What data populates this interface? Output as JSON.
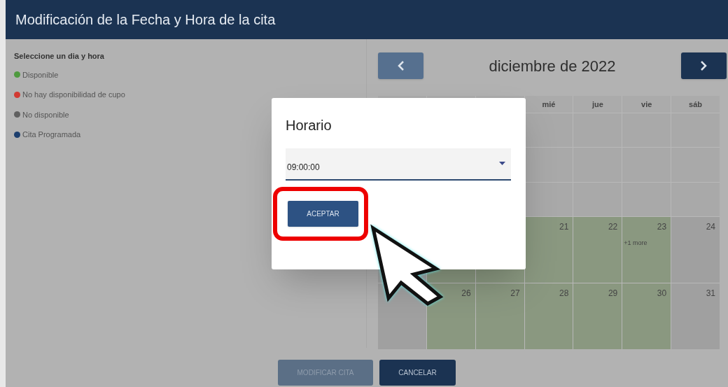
{
  "header": {
    "title": "Modificación de la Fecha y Hora de la cita"
  },
  "legend": {
    "title": "Seleccione un dia y hora",
    "items": [
      {
        "label": "Disponible",
        "color": "#4f9a3f"
      },
      {
        "label": "No hay disponibilidad de cupo",
        "color": "#d23a32"
      },
      {
        "label": "No disponible",
        "color": "#606060"
      },
      {
        "label": "Cita Programada",
        "color": "#1d3f6e"
      }
    ]
  },
  "calendar": {
    "month": "diciembre de 2022",
    "prev": {
      "disabled": true
    },
    "next": {
      "disabled": false
    },
    "weekdays": [
      "mié",
      "jue",
      "vie",
      "sáb"
    ],
    "weeks": [
      [
        {
          "kind": "past"
        },
        {
          "kind": "past"
        },
        {
          "kind": "past"
        },
        {
          "kind": "past"
        }
      ],
      [
        {
          "kind": "past"
        },
        {
          "kind": "past"
        },
        {
          "kind": "past"
        },
        {
          "kind": "past"
        }
      ],
      [
        {
          "kind": "past"
        },
        {
          "kind": "past"
        },
        {
          "kind": "past"
        },
        {
          "kind": "past"
        }
      ],
      [
        {
          "kind": "weekend"
        },
        {
          "kind": "available"
        },
        {
          "kind": "available"
        },
        {
          "kind": "available",
          "day": "21"
        },
        {
          "kind": "available",
          "day": "22"
        },
        {
          "kind": "available",
          "day": "23",
          "more": "+1 more"
        },
        {
          "kind": "weekend",
          "day": "24"
        }
      ],
      [
        {
          "kind": "weekend"
        },
        {
          "kind": "available",
          "day": "26"
        },
        {
          "kind": "available",
          "day": "27"
        },
        {
          "kind": "available",
          "day": "28"
        },
        {
          "kind": "available",
          "day": "29"
        },
        {
          "kind": "available",
          "day": "30"
        },
        {
          "kind": "weekend",
          "day": "31"
        }
      ]
    ]
  },
  "dialog": {
    "title": "Horario",
    "select_value": "09:00:00",
    "button": "ACEPTAR"
  },
  "footer": {
    "buttons": [
      {
        "label": "MODIFICAR CITA",
        "disabled": true
      },
      {
        "label": "CANCELAR",
        "disabled": false
      }
    ]
  }
}
